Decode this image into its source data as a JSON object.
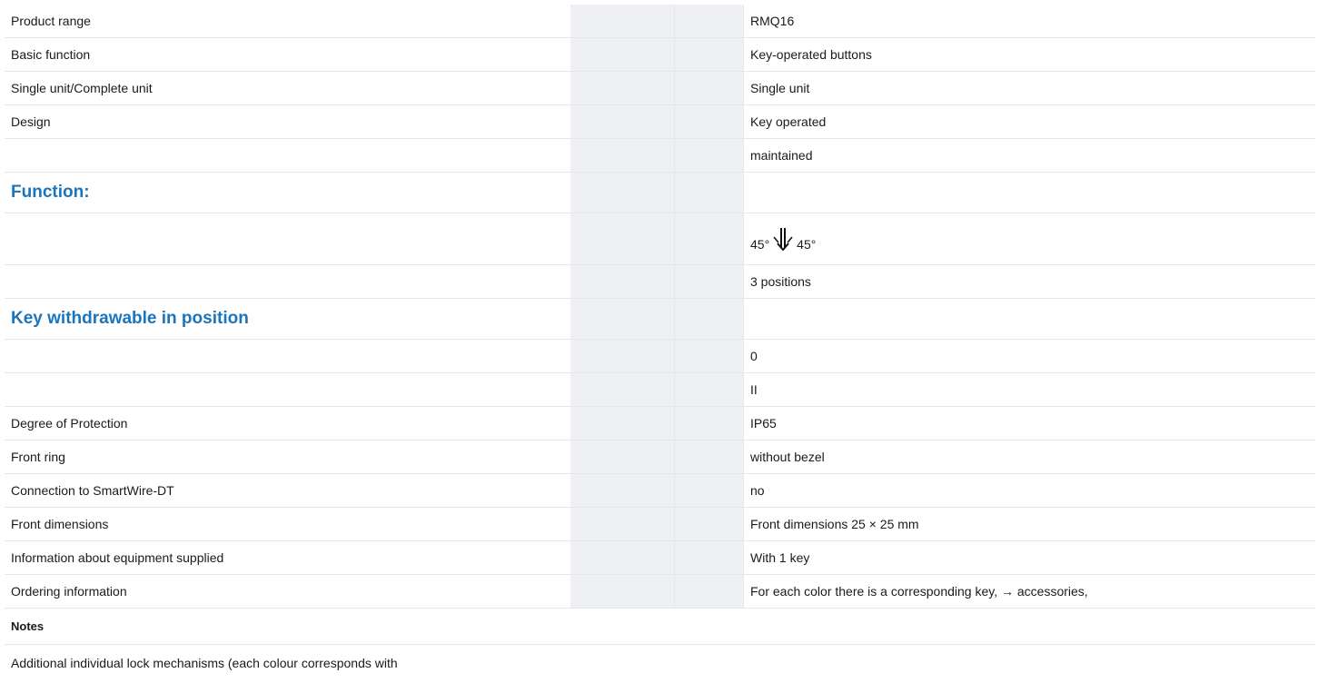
{
  "rows": [
    {
      "label": "Product range",
      "value": "RMQ16"
    },
    {
      "label": "Basic function",
      "value": "Key-operated buttons"
    },
    {
      "label": "Single unit/Complete unit",
      "value": "Single unit"
    },
    {
      "label": "Design",
      "value": "Key operated"
    },
    {
      "label": "",
      "value": "maintained"
    },
    {
      "label": "Function:",
      "value": ""
    },
    {
      "label": "",
      "value_left": "45°",
      "value_right": "45°",
      "icon": "key-switch-arrows-icon"
    },
    {
      "label": "",
      "value": "3 positions"
    },
    {
      "label": "Key withdrawable in position",
      "value": ""
    },
    {
      "label": "",
      "value": "0"
    },
    {
      "label": "",
      "value": "II"
    },
    {
      "label": "Degree of Protection",
      "value": "IP65"
    },
    {
      "label": "Front ring",
      "value": "without bezel"
    },
    {
      "label": "Connection to SmartWire-DT",
      "value": "no"
    },
    {
      "label": "Front dimensions",
      "value": "Front dimensions 25 × 25 mm"
    },
    {
      "label": "Information about equipment supplied",
      "value": "With 1 key"
    },
    {
      "label": "Ordering information",
      "value": "For each color there is a corresponding key, → accessories,"
    }
  ],
  "notes": {
    "heading": "Notes",
    "text": "Additional individual lock mechanisms (each colour corresponds with"
  },
  "colors": {
    "section_heading": "#1b75bc",
    "mid_column": "#eef0f3"
  }
}
